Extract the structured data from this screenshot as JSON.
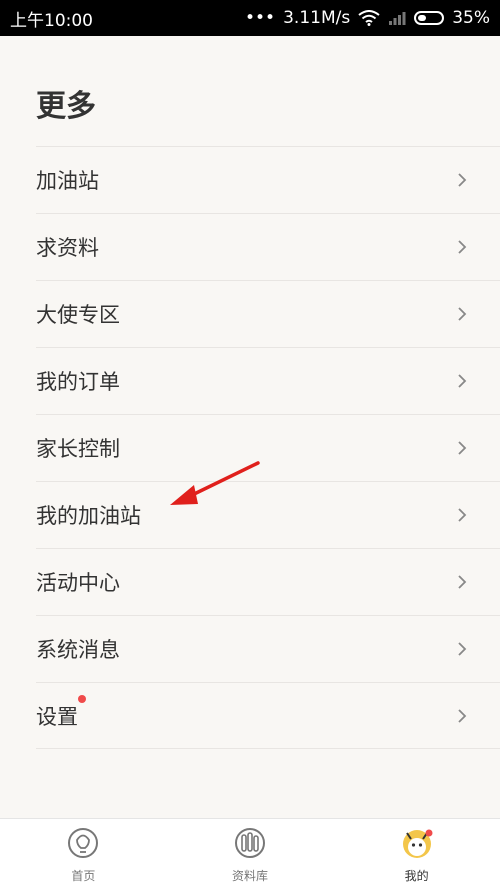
{
  "status_bar": {
    "time": "上午10:00",
    "network_speed": "3.11M/s",
    "battery": "35%",
    "battery_level": 0.35
  },
  "page": {
    "title": "更多",
    "menu_items": [
      {
        "label": "加油站",
        "icon": "chevron-right-icon"
      },
      {
        "label": "求资料",
        "icon": "chevron-right-icon"
      },
      {
        "label": "大使专区",
        "icon": "chevron-right-icon"
      },
      {
        "label": "我的订单",
        "icon": "chevron-right-icon"
      },
      {
        "label": "家长控制",
        "icon": "chevron-right-icon"
      },
      {
        "label": "我的加油站",
        "icon": "chevron-right-icon"
      },
      {
        "label": "活动中心",
        "icon": "chevron-right-icon"
      },
      {
        "label": "系统消息",
        "icon": "chevron-right-icon"
      },
      {
        "label": "设置",
        "icon": "chevron-right-icon",
        "badge_dot": true
      }
    ]
  },
  "tab_bar": {
    "tabs": [
      {
        "label": "首页",
        "icon": "home-bulb-icon"
      },
      {
        "label": "资料库",
        "icon": "library-icon"
      },
      {
        "label": "我的",
        "icon": "profile-avatar-icon",
        "active": true,
        "badge_dot": true
      }
    ]
  },
  "colors": {
    "background": "#f9f7f4",
    "text": "#333333",
    "badge": "#f04a4a",
    "annotation_arrow": "#e0201c"
  }
}
